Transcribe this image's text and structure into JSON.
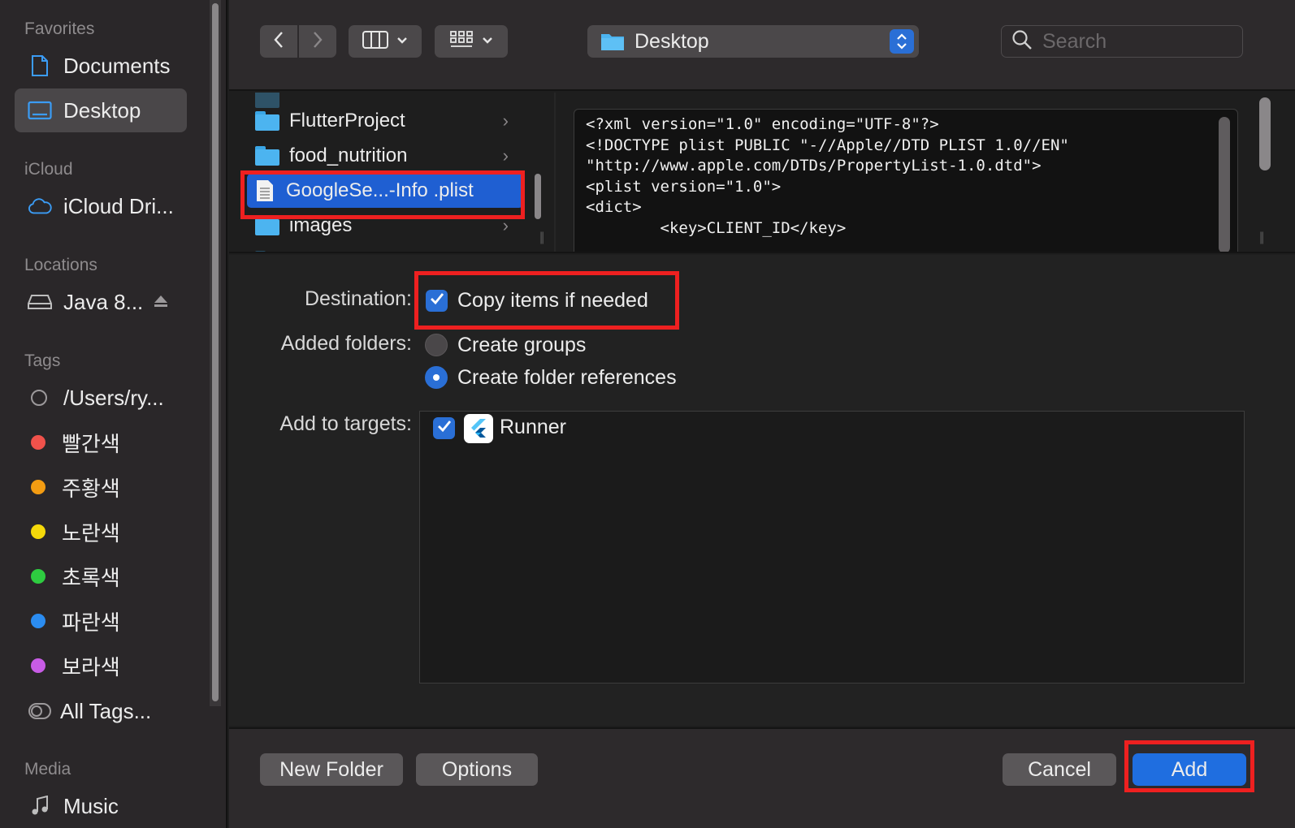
{
  "sidebar": {
    "favorites_header": "Favorites",
    "favorites": [
      {
        "label": "Documents",
        "icon": "document-icon"
      },
      {
        "label": "Desktop",
        "icon": "desktop-icon",
        "active": true
      }
    ],
    "icloud_header": "iCloud",
    "icloud": [
      {
        "label": "iCloud Dri...",
        "icon": "cloud-icon"
      }
    ],
    "locations_header": "Locations",
    "locations": [
      {
        "label": "Java 8...",
        "icon": "drive-icon"
      }
    ],
    "tags_header": "Tags",
    "tags": [
      {
        "label": "/Users/ry...",
        "color": ""
      },
      {
        "label": "빨간색",
        "color": "#f0524b"
      },
      {
        "label": "주황색",
        "color": "#f39c12"
      },
      {
        "label": "노란색",
        "color": "#f5d90a"
      },
      {
        "label": "초록색",
        "color": "#2ecc40"
      },
      {
        "label": "파란색",
        "color": "#2b8cf0"
      },
      {
        "label": "보라색",
        "color": "#c85ce6"
      },
      {
        "label": "All Tags...",
        "color": ""
      }
    ],
    "media_header": "Media",
    "media": [
      {
        "label": "Music",
        "icon": "music-icon"
      }
    ]
  },
  "toolbar": {
    "location": "Desktop",
    "search_placeholder": "Search"
  },
  "browser": {
    "items": [
      {
        "label": "FlutterProject",
        "type": "folder"
      },
      {
        "label": "food_nutrition",
        "type": "folder"
      },
      {
        "label": "GoogleSe...-Info .plist",
        "type": "file",
        "selected": true
      },
      {
        "label": "images",
        "type": "folder"
      }
    ],
    "preview_lines": [
      "<?xml version=\"1.0\" encoding=\"UTF-8\"?>",
      "<!DOCTYPE plist PUBLIC \"-//Apple//DTD PLIST 1.0//EN\"",
      "\"http://www.apple.com/DTDs/PropertyList-1.0.dtd\">",
      "<plist version=\"1.0\">",
      "<dict>",
      "        <key>CLIENT_ID</key>"
    ]
  },
  "options": {
    "destination_label": "Destination:",
    "copy_items": "Copy items if needed",
    "added_folders_label": "Added folders:",
    "create_groups": "Create groups",
    "create_folder_refs": "Create folder references",
    "add_to_targets_label": "Add to targets:",
    "target_runner": "Runner"
  },
  "footer": {
    "new_folder": "New Folder",
    "options": "Options",
    "cancel": "Cancel",
    "add": "Add"
  }
}
